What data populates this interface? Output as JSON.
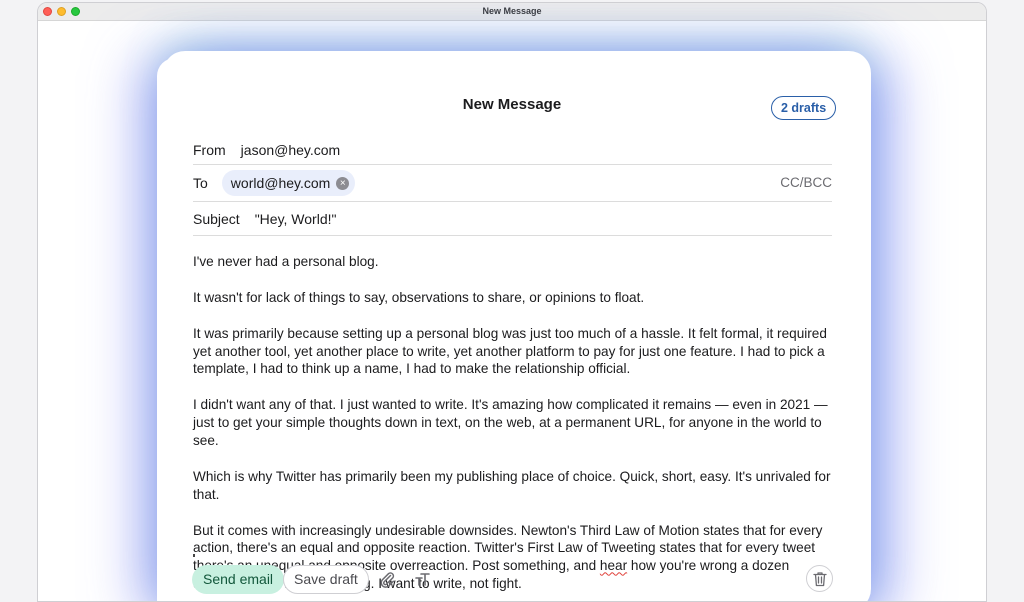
{
  "window": {
    "title": "New Message"
  },
  "composer": {
    "title": "New Message",
    "drafts_badge": "2 drafts",
    "from": {
      "label": "From",
      "value": "jason@hey.com"
    },
    "to": {
      "label": "To",
      "recipients": [
        "world@hey.com"
      ],
      "cc_bcc": "CC/BCC"
    },
    "subject": {
      "label": "Subject",
      "value": "\"Hey, World!\""
    },
    "body": {
      "p1": "I've never had a personal blog.",
      "p2": "It wasn't for lack of things to say, observations to share, or opinions to float.",
      "p3": "It was primarily because setting up a personal blog was just too much of a hassle. It felt formal, it required yet another tool, yet another place to write, yet another platform to pay for just one feature. I had to pick a template, I had to think up a name, I had to make the relationship official.",
      "p4": "I didn't want any of that. I just wanted to write. It's amazing how complicated it remains — even in 2021 — just to get your simple thoughts down in text, on the web, at a permanent URL, for anyone in the world to see.",
      "p5": "Which is why Twitter has primarily been my publishing place of choice. Quick, short, easy. It's unrivaled for that.",
      "p6_before": "But it comes with increasingly undesirable downsides. Newton's Third Law of Motion states that for every action, there's an equal and opposite reaction. Twitter's First Law of Tweeting states that for every tweet there's an unequal and opposite overreaction. Post something, and ",
      "p6_squiggle": "hear",
      "p6_after": " how you're wrong a dozen different ways. It's exhausting. I want to write, not fight."
    },
    "actions": {
      "send": "Send email",
      "save_draft": "Save draft",
      "attach_icon": "paperclip-icon",
      "format_icon": "text-format-icon",
      "trash_icon": "trash-icon"
    }
  },
  "colors": {
    "send_bg": "#c8f0e0",
    "send_text": "#12573b",
    "badge": "#2a5fa8",
    "chip_bg": "#e9eefb"
  }
}
